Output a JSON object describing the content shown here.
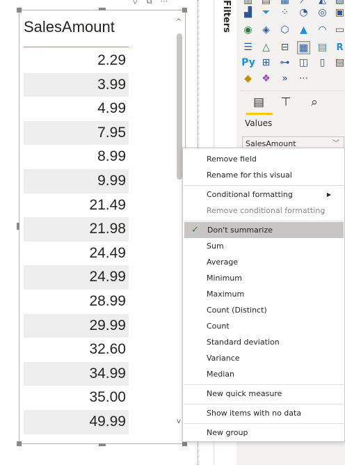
{
  "table_visual": {
    "column_header": "SalesAmount",
    "rows": [
      "2.29",
      "3.99",
      "4.99",
      "7.95",
      "8.99",
      "9.99",
      "21.49",
      "21.98",
      "24.49",
      "24.99",
      "28.99",
      "29.99",
      "32.60",
      "34.99",
      "35.00",
      "49.99"
    ],
    "scroll_up_glyph": "^",
    "scroll_down_glyph": "v",
    "header_icons": [
      "filter-icon",
      "focus-mode-icon",
      "more-options-icon"
    ]
  },
  "filters_pane": {
    "label": "Filters"
  },
  "visualizations_pane": {
    "values_label": "Values",
    "field_well_value": "SalesAmount",
    "python_label": "Py",
    "r_label": "R",
    "more_glyph": "···"
  },
  "context_menu": {
    "items": {
      "remove_field": "Remove field",
      "rename": "Rename for this visual",
      "conditional_formatting": "Conditional formatting",
      "remove_conditional_formatting": "Remove conditional formatting",
      "dont_summarize": "Don't summarize",
      "sum": "Sum",
      "average": "Average",
      "minimum": "Minimum",
      "maximum": "Maximum",
      "count_distinct": "Count (Distinct)",
      "count": "Count",
      "std_dev": "Standard deviation",
      "variance": "Variance",
      "median": "Median",
      "new_quick_measure": "New quick measure",
      "show_items_no_data": "Show items with no data",
      "new_group": "New group"
    },
    "selected": "Don't summarize",
    "check_glyph": "✓",
    "submenu_glyph": "▶"
  },
  "colors": {
    "accent_yellow": "#f2c811",
    "header_underline": "#6ea1d6",
    "alt_row": "#eeeeee",
    "selected_item": "#c8c6c4"
  }
}
